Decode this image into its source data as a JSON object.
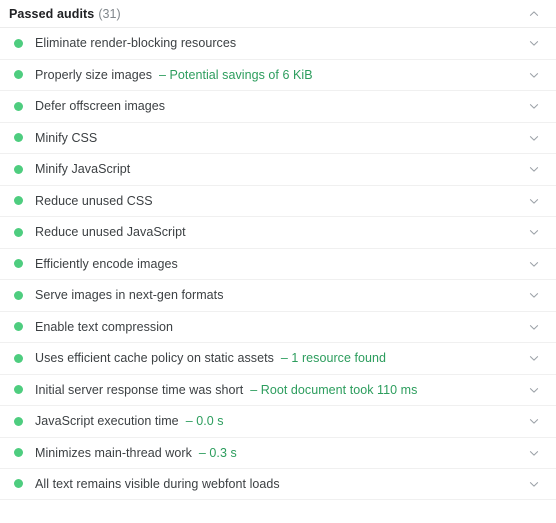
{
  "panel": {
    "header": {
      "title": "Passed audits",
      "count": "(31)",
      "collapse_icon": "chevron-up-icon"
    },
    "row_expand_icon": "chevron-down-icon",
    "status_icon": "pass-dot-icon",
    "colors": {
      "pass_dot": "#4ecd7f",
      "sub_text": "#2c9d5d",
      "title_text": "#3c4043",
      "count_text": "#80868b",
      "divider": "#f0f0f0",
      "background": "#ffffff"
    },
    "audits": [
      {
        "title": "Eliminate render-blocking resources",
        "detail": ""
      },
      {
        "title": "Properly size images",
        "detail": "– Potential savings of 6 KiB"
      },
      {
        "title": "Defer offscreen images",
        "detail": ""
      },
      {
        "title": "Minify CSS",
        "detail": ""
      },
      {
        "title": "Minify JavaScript",
        "detail": ""
      },
      {
        "title": "Reduce unused CSS",
        "detail": ""
      },
      {
        "title": "Reduce unused JavaScript",
        "detail": ""
      },
      {
        "title": "Efficiently encode images",
        "detail": ""
      },
      {
        "title": "Serve images in next-gen formats",
        "detail": ""
      },
      {
        "title": "Enable text compression",
        "detail": ""
      },
      {
        "title": "Uses efficient cache policy on static assets",
        "detail": "– 1 resource found"
      },
      {
        "title": "Initial server response time was short",
        "detail": "– Root document took 110 ms"
      },
      {
        "title": "JavaScript execution time",
        "detail": "– 0.0 s"
      },
      {
        "title": "Minimizes main-thread work",
        "detail": "– 0.3 s"
      },
      {
        "title": "All text remains visible during webfont loads",
        "detail": ""
      }
    ]
  }
}
